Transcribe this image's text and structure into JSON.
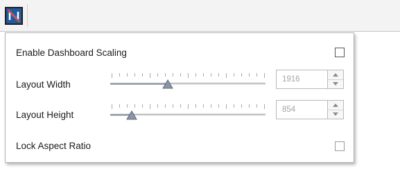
{
  "toolbar": {
    "dashboard_scaling_button_icon": "dashboard-scaling-icon"
  },
  "popup": {
    "enable_scaling": {
      "label": "Enable Dashboard Scaling",
      "checked": false
    },
    "layout_width": {
      "label": "Layout Width",
      "value": "1916",
      "slider_fraction": 0.37
    },
    "layout_height": {
      "label": "Layout Height",
      "value": "854",
      "slider_fraction": 0.14
    },
    "lock_aspect_ratio": {
      "label": "Lock Aspect Ratio",
      "checked": false
    }
  },
  "colors": {
    "icon_blue": "#1f5aa0",
    "icon_slash": "#e23a2b",
    "disabled_text": "#a4a4a4"
  }
}
